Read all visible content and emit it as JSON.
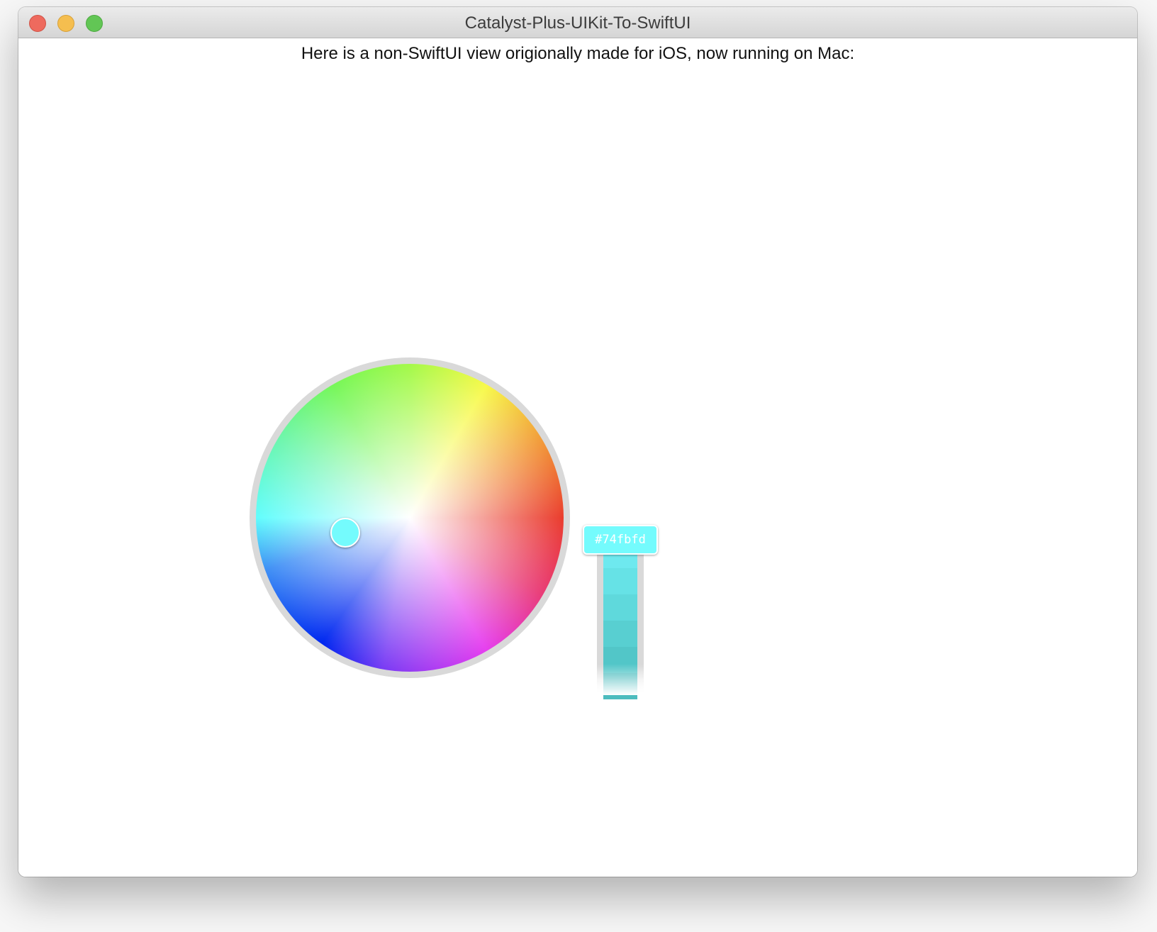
{
  "window": {
    "title": "Catalyst-Plus-UIKit-To-SwiftUI"
  },
  "content": {
    "caption": "Here is a non-SwiftUI view origionally made for iOS, now running on Mac:"
  },
  "color_picker": {
    "selected_hex": "#74fbfd",
    "selected_color": "#74fbfd",
    "brightness_swatches": [
      "#6ee9ef",
      "#66e2e6",
      "#5fd9dc",
      "#58cfd1",
      "#52c6c8",
      "#4cbcbe"
    ]
  }
}
